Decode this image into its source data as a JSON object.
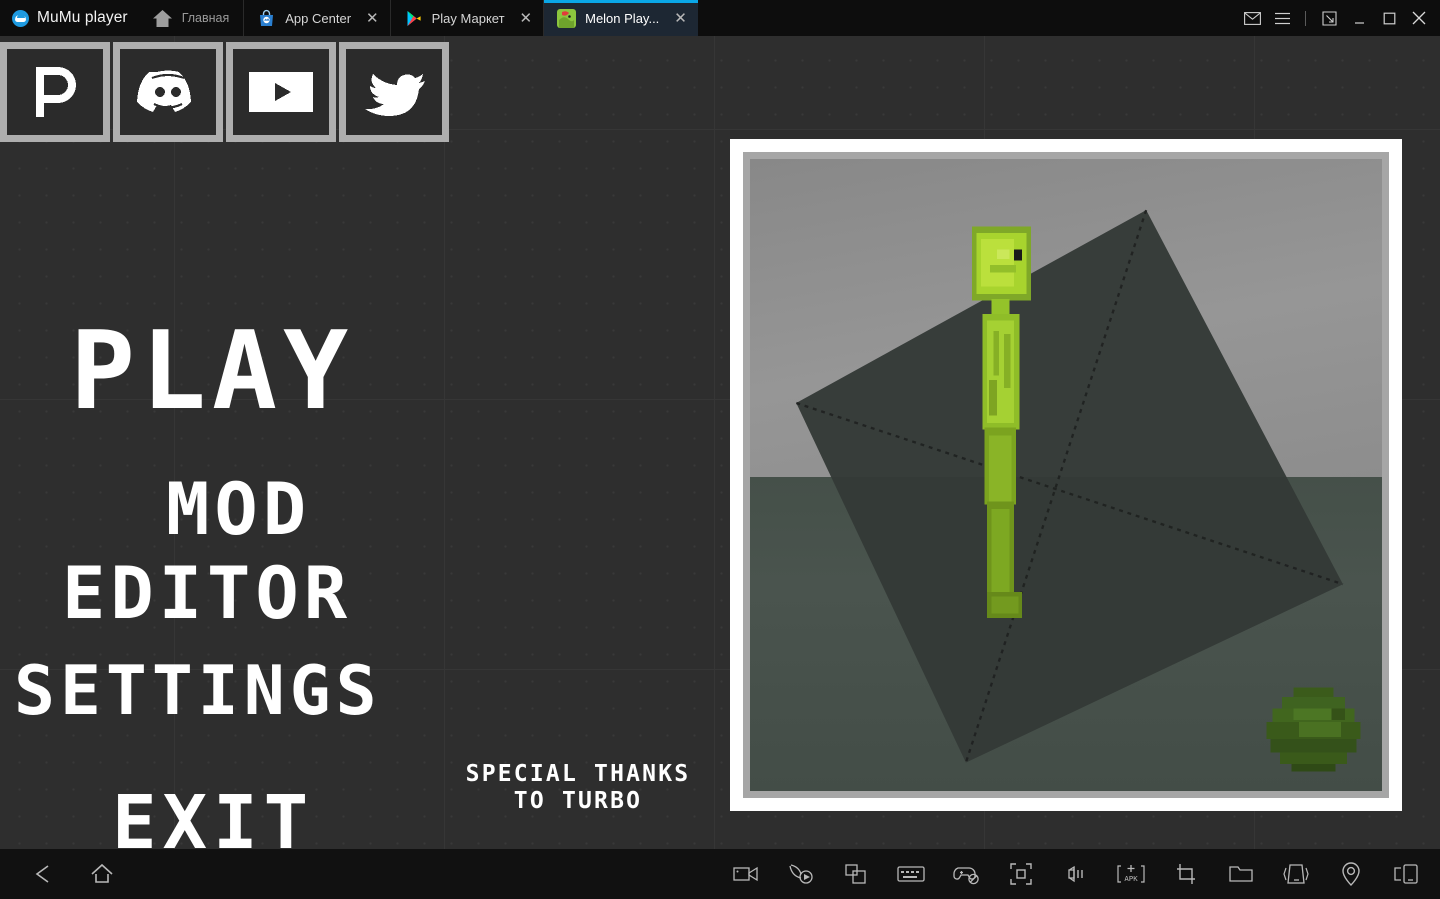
{
  "window": {
    "brand": "MuMu player",
    "home_label": "Главная",
    "home_icon": "home-icon",
    "controls": [
      {
        "name": "mail-icon",
        "label": "Mail"
      },
      {
        "name": "menu-icon",
        "label": "Menu"
      },
      {
        "name": "restore-icon",
        "label": "Restore"
      },
      {
        "name": "minimize-icon",
        "label": "Minimize"
      },
      {
        "name": "maximize-icon",
        "label": "Maximize"
      },
      {
        "name": "close-icon",
        "label": "Close"
      }
    ]
  },
  "tabs": [
    {
      "title": "App Center",
      "icon": "app-center-icon",
      "close": "✕",
      "active": false
    },
    {
      "title": "Play Маркет",
      "icon": "google-play-icon",
      "close": "✕",
      "active": false
    },
    {
      "title": "Melon Play...",
      "icon": "melon-playground-icon",
      "close": "✕",
      "active": true
    }
  ],
  "socials": [
    {
      "name": "patreon-button",
      "label": "Patreon"
    },
    {
      "name": "discord-button",
      "label": "Discord"
    },
    {
      "name": "youtube-button",
      "label": "YouTube"
    },
    {
      "name": "twitter-button",
      "label": "Twitter"
    }
  ],
  "menu": {
    "play": "PLAY",
    "mod": "MOD",
    "editor": "EDITOR",
    "settings": "SETTINGS",
    "exit": "EXIT",
    "thanks_line1": "SPECIAL THANKS",
    "thanks_line2": "TO TURBO"
  },
  "preview": {
    "name": "game-preview",
    "description": "Green pixel ragdoll standing on a dark tilted square platform with a melon on the ground"
  },
  "toolbar": {
    "left": [
      {
        "name": "back-button",
        "label": "Back"
      },
      {
        "name": "home-button",
        "label": "Home"
      }
    ],
    "right": [
      {
        "name": "record-video-button",
        "label": "Record video"
      },
      {
        "name": "macro-record-button",
        "label": "Operation record"
      },
      {
        "name": "multi-instance-button",
        "label": "Multi-instance"
      },
      {
        "name": "keyboard-mapping-button",
        "label": "Keyboard mapping"
      },
      {
        "name": "gamepad-disabled-button",
        "label": "Gamepad (off)"
      },
      {
        "name": "fullscreen-button",
        "label": "Full screen"
      },
      {
        "name": "volume-button",
        "label": "Volume"
      },
      {
        "name": "install-apk-button",
        "label": "Install APK"
      },
      {
        "name": "screenshot-button",
        "label": "Screenshot"
      },
      {
        "name": "shared-folder-button",
        "label": "Shared folder"
      },
      {
        "name": "shake-button",
        "label": "Shake"
      },
      {
        "name": "location-button",
        "label": "Location"
      },
      {
        "name": "rotate-screen-button",
        "label": "Rotate screen"
      }
    ]
  },
  "colors": {
    "accent": "#0aa7e8",
    "titlebar_bg": "#0d0d0d",
    "active_tab_bg": "#1d2733",
    "game_bg": "#2e2e2e",
    "toolbar_bg": "#111111",
    "menu_text": "#ffffff",
    "frame_outer": "#ffffff",
    "frame_inner": "#a6a6a6",
    "char_green": "#9acb2a",
    "melon_green": "#3f5a1d"
  }
}
